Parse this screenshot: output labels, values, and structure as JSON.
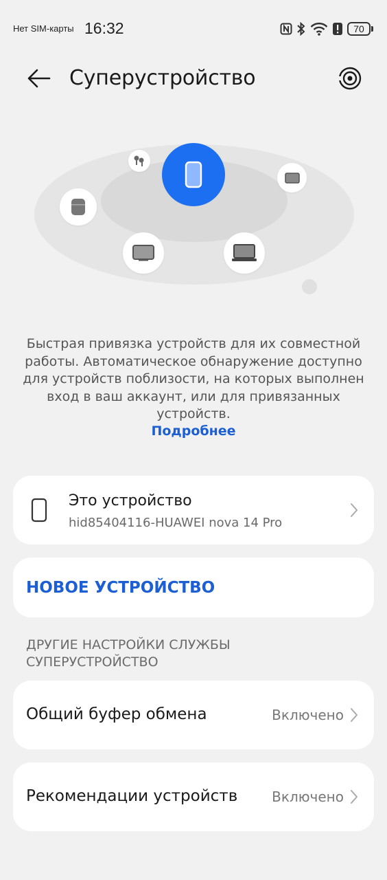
{
  "status_bar": {
    "carrier": "Нет SIM-карты",
    "time": "16:32",
    "battery": "70",
    "icons": [
      "nfc-icon",
      "bluetooth-icon",
      "wifi-icon",
      "alert-icon",
      "battery-icon"
    ]
  },
  "header": {
    "title": "Суперустройство",
    "back_icon": "arrow-left-icon",
    "action_icon": "radar-icon"
  },
  "illustration": {
    "center_device": "phone",
    "nearby_devices": [
      "earbuds",
      "tablet",
      "speaker",
      "monitor",
      "laptop"
    ],
    "accent_color": "#1d6ff2"
  },
  "description": {
    "text": "Быстрая привязка устройств для их совместной работы. Автоматическое обнаружение доступно для устройств поблизости, на которых выполнен вход в ваш аккаунт, или для привязанных устройств.",
    "link": "Подробнее"
  },
  "this_device": {
    "title": "Это устройство",
    "name": "hid85404116-HUAWEI nova 14 Pro"
  },
  "new_device": {
    "label": "НОВОЕ УСТРОЙСТВО"
  },
  "other_settings": {
    "section_title": "ДРУГИЕ НАСТРОЙКИ СЛУЖБЫ СУПЕРУСТРОЙСТВО",
    "items": [
      {
        "label": "Общий буфер обмена",
        "value": "Включено"
      },
      {
        "label": "Рекомендации устройств",
        "value": "Включено"
      }
    ]
  },
  "colors": {
    "background": "#f1f1f1",
    "card": "#ffffff",
    "accent": "#1c5fd4"
  }
}
